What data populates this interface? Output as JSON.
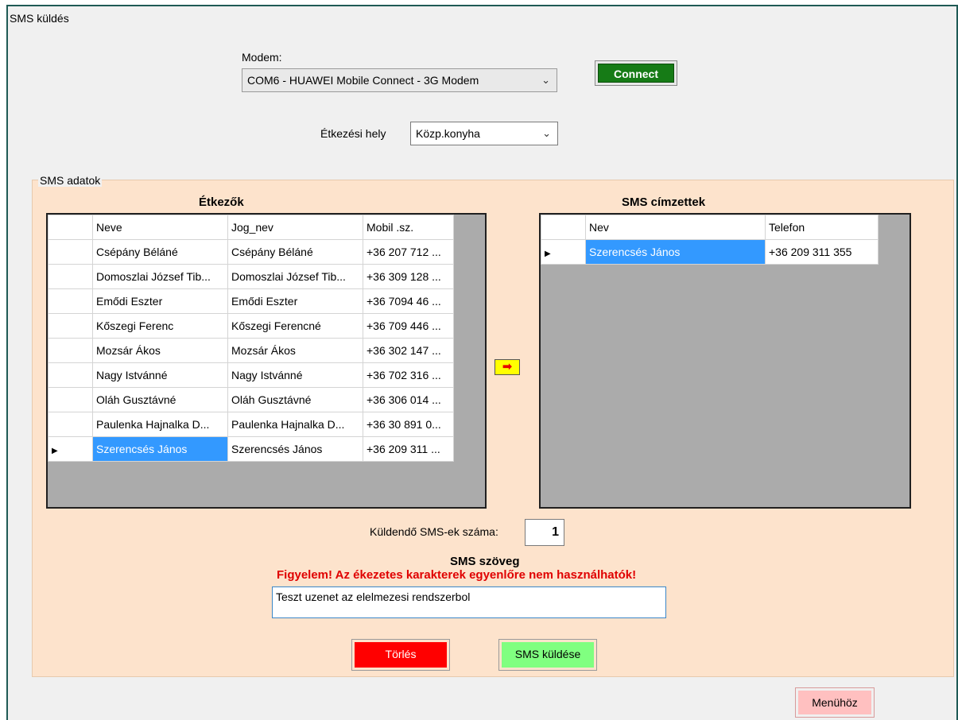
{
  "window": {
    "title": "SMS küldés"
  },
  "modem": {
    "label": "Modem:",
    "selected": "COM6 - HUAWEI Mobile Connect - 3G Modem",
    "connect_label": "Connect"
  },
  "location": {
    "label": "Étkezési hely",
    "selected": "Közp.konyha"
  },
  "sms_group": {
    "caption": "SMS adatok"
  },
  "diners": {
    "heading": "Étkezők",
    "columns": [
      "Neve",
      "Jog_nev",
      "Mobil .sz."
    ],
    "rows": [
      [
        "Csépány Béláné",
        "Csépány Béláné",
        "+36 207 712 ..."
      ],
      [
        "Domoszlai József Tib...",
        "Domoszlai József Tib...",
        "+36 309 128 ..."
      ],
      [
        "Emődi Eszter",
        "Emődi Eszter",
        "+36 7094 46 ..."
      ],
      [
        "Kőszegi Ferenc",
        "Kőszegi Ferencné",
        "+36 709 446 ..."
      ],
      [
        "Mozsár Ákos",
        "Mozsár Ákos",
        "+36 302 147 ..."
      ],
      [
        "Nagy Istvánné",
        "Nagy Istvánné",
        "+36 702 316 ..."
      ],
      [
        "Oláh Gusztávné",
        "Oláh Gusztávné",
        "+36 306 014 ..."
      ],
      [
        "Paulenka Hajnalka D...",
        "Paulenka Hajnalka D...",
        "+36 30 891 0..."
      ],
      [
        "Szerencsés János",
        "Szerencsés János",
        "+36 209 311 ..."
      ]
    ]
  },
  "recipients": {
    "heading": "SMS címzettek",
    "columns": [
      "Nev",
      "Telefon"
    ],
    "rows": [
      [
        "Szerencsés János",
        "+36 209 311 355"
      ]
    ]
  },
  "count": {
    "label": "Küldendő SMS-ek száma:",
    "value": "1"
  },
  "message": {
    "heading": "SMS szöveg",
    "warning": "Figyelem! Az ékezetes karakterek egyenlőre nem használhatók!",
    "text": "Teszt uzenet az elelmezesi rendszerbol"
  },
  "buttons": {
    "clear": "Törlés",
    "send": "SMS küldése",
    "menu": "Menühöz"
  },
  "icons": {
    "dropdown": "chevron-down-icon",
    "row_marker": "triangle-right-icon",
    "transfer": "arrow-right-icon"
  },
  "colors": {
    "connect": "#167b16",
    "clear": "#ff0000",
    "send": "#80ff80",
    "menu": "#ffc0c0",
    "panel": "#fde3cc",
    "selection": "#3399ff",
    "warning": "#e00000"
  }
}
